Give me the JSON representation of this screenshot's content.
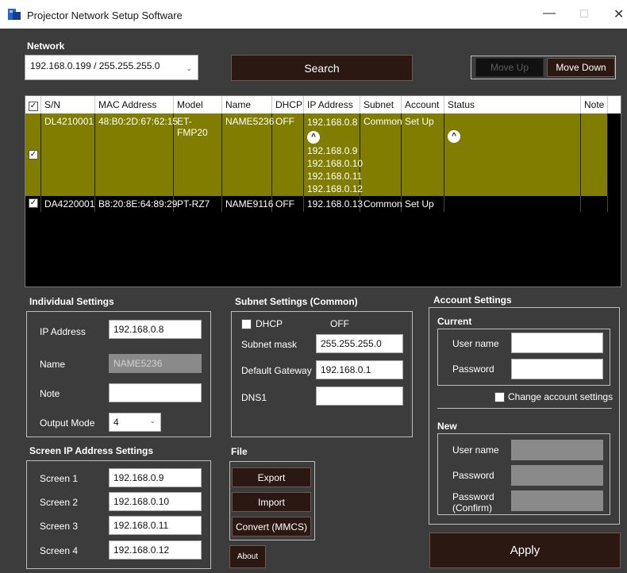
{
  "window": {
    "title": "Projector Network Setup Software",
    "minimize": "—",
    "maximize": "☐",
    "close": "✕"
  },
  "network": {
    "label": "Network",
    "selected": "192.168.0.199 / 255.255.255.0",
    "search_label": "Search",
    "move_up_label": "Move Up",
    "move_down_label": "Move Down"
  },
  "table": {
    "columns": [
      "S/N",
      "MAC Address",
      "Model",
      "Name",
      "DHCP",
      "IP Address",
      "Subnet",
      "Account",
      "Status",
      "Note"
    ],
    "rows": [
      {
        "sn": "DL4210001",
        "mac": "48:B0:2D:67:62:15",
        "model": "ET-FMP20",
        "name": "NAME5236",
        "dhcp": "OFF",
        "ip": "192.168.0.8",
        "ip_extra": [
          "192.168.0.9",
          "192.168.0.10",
          "192.168.0.11",
          "192.168.0.12"
        ],
        "subnet": "Common",
        "account": "Set Up",
        "status": "",
        "note": "",
        "checked": true,
        "highlight": "#807d00"
      },
      {
        "sn": "DA4220001",
        "mac": "B8:20:8E:64:89:29",
        "model": "PT-RZ7",
        "name": "NAME9116",
        "dhcp": "OFF",
        "ip": "192.168.0.13",
        "subnet": "Common",
        "account": "Set Up",
        "status": "",
        "note": "",
        "checked": true
      }
    ]
  },
  "individual": {
    "title": "Individual Settings",
    "ip_label": "IP Address",
    "ip_value": "192.168.0.8",
    "name_label": "Name",
    "name_value": "NAME5236",
    "note_label": "Note",
    "note_value": "",
    "output_label": "Output Mode",
    "output_value": "4"
  },
  "screen": {
    "title": "Screen IP Address Settings",
    "items": [
      {
        "label": "Screen 1",
        "value": "192.168.0.9"
      },
      {
        "label": "Screen 2",
        "value": "192.168.0.10"
      },
      {
        "label": "Screen 3",
        "value": "192.168.0.11"
      },
      {
        "label": "Screen 4",
        "value": "192.168.0.12"
      }
    ]
  },
  "subnet": {
    "title": "Subnet Settings (Common)",
    "dhcp_label": "DHCP",
    "dhcp_value": "OFF",
    "mask_label": "Subnet mask",
    "mask_value": "255.255.255.0",
    "gateway_label": "Default Gateway",
    "gateway_value": "192.168.0.1",
    "dns_label": "DNS1",
    "dns_value": ""
  },
  "file": {
    "title": "File",
    "export_label": "Export",
    "import_label": "Import",
    "convert_label": "Convert (MMCS)",
    "about_label": "About"
  },
  "account": {
    "title": "Account Settings",
    "current_title": "Current",
    "user_label": "User name",
    "password_label": "Password",
    "change_label": "Change account settings",
    "new_title": "New",
    "new_user_label": "User name",
    "new_password_label": "Password",
    "confirm_label_1": "Password",
    "confirm_label_2": "(Confirm)",
    "apply_label": "Apply"
  }
}
